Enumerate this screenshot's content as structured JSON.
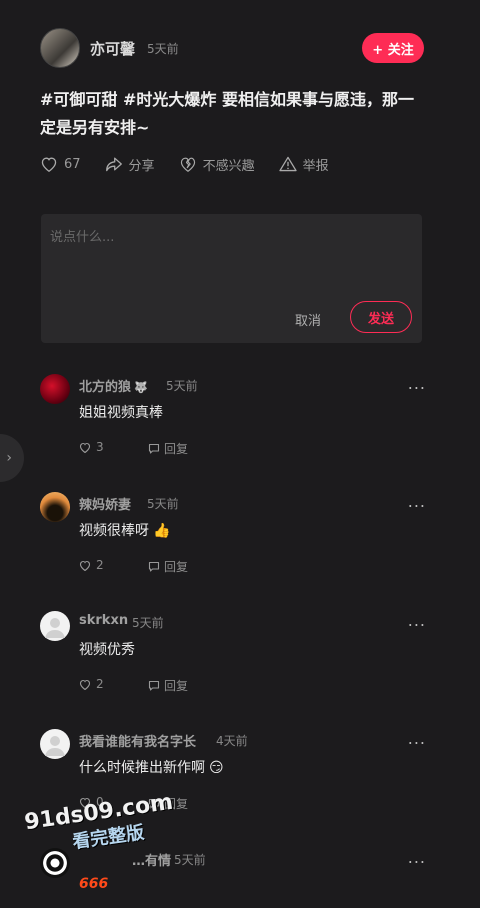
{
  "post": {
    "author": "亦可馨",
    "time": "5天前",
    "follow_label": "+ 关注",
    "text": "#可御可甜 #时光大爆炸 要相信如果事与愿违，那一定是另有安排~"
  },
  "actions": {
    "likes": "67",
    "share": "分享",
    "not_interested": "不感兴趣",
    "report": "举报"
  },
  "reply_box": {
    "placeholder": "说点什么...",
    "cancel_label": "取消",
    "send_label": "发送"
  },
  "comments": [
    {
      "user": "北方的狼",
      "user_emoji": "🐺",
      "time": "5天前",
      "text": "姐姐视频真棒",
      "emoji": "",
      "likes": "3",
      "reply_label": "回复"
    },
    {
      "user": "辣妈娇妻",
      "user_emoji": "",
      "time": "5天前",
      "text": "视频很棒呀",
      "emoji": "👍",
      "likes": "2",
      "reply_label": "回复"
    },
    {
      "user": "skrkxn",
      "user_emoji": "",
      "time": "5天前",
      "text": "视频优秀",
      "emoji": "",
      "likes": "2",
      "reply_label": "回复"
    },
    {
      "user": "我看谁能有我名字长",
      "user_emoji": "",
      "time": "4天前",
      "text": "什么时候推出新作啊",
      "emoji": "😏",
      "likes": "0",
      "reply_label": "回复"
    },
    {
      "user": "…有情",
      "user_emoji": "",
      "time": "5天前",
      "text": "666",
      "emoji": "",
      "likes": "",
      "reply_label": ""
    }
  ],
  "more_label": "...",
  "side_tab_glyph": "›",
  "watermark": {
    "line1": "91ds09.com",
    "line2": "看完整版"
  },
  "colors": {
    "accent": "#fe2c55",
    "background": "#1c1b1d",
    "input_bg": "#2a292b"
  }
}
